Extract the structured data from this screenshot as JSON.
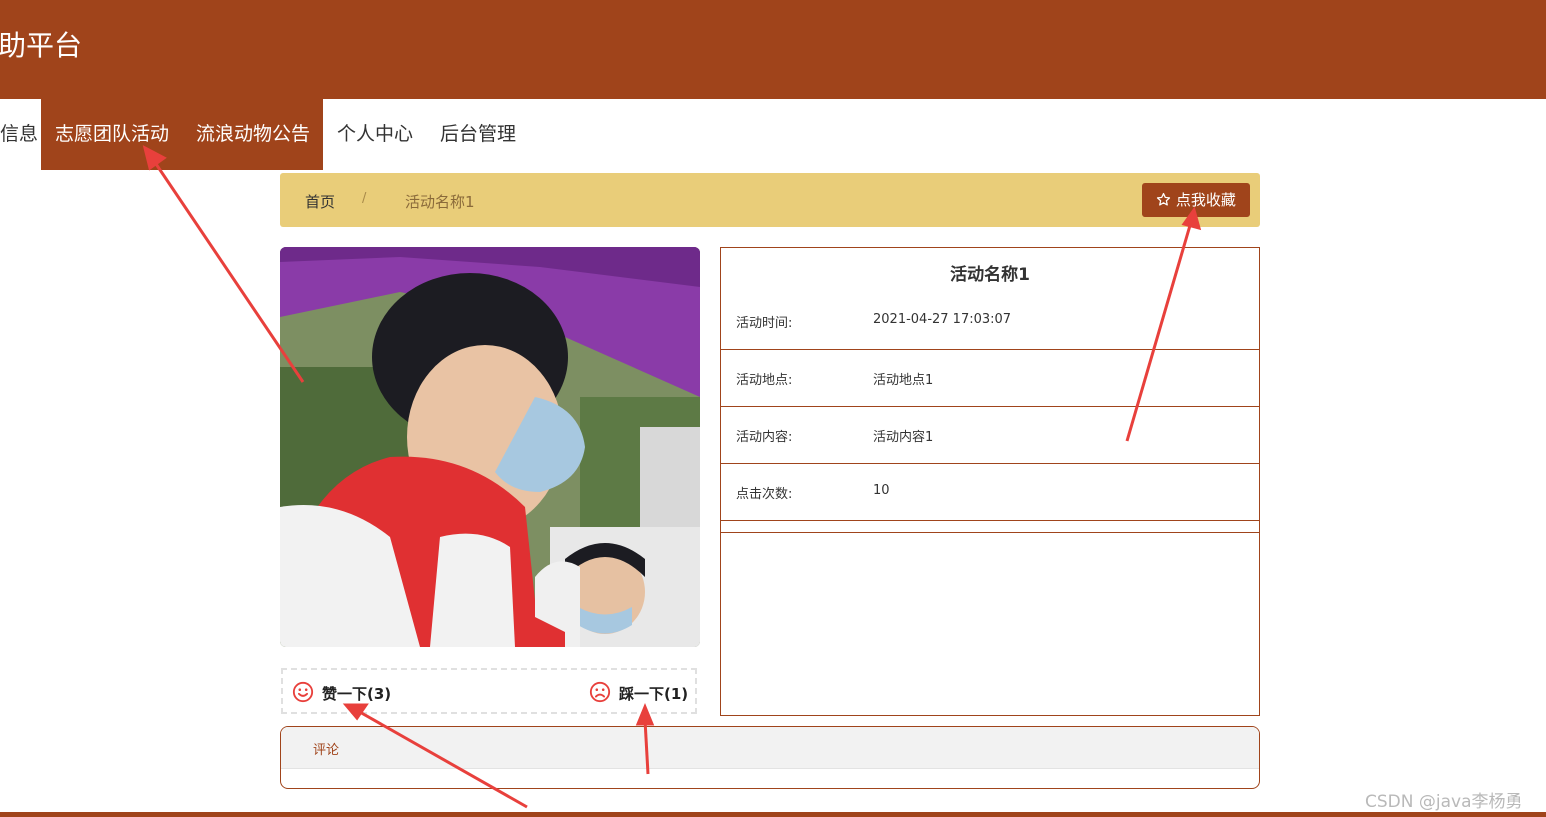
{
  "header": {
    "title": "助平台"
  },
  "nav": {
    "items": [
      {
        "label": "信息"
      },
      {
        "label": "志愿团队活动"
      },
      {
        "label": "流浪动物公告"
      },
      {
        "label": "个人中心"
      },
      {
        "label": "后台管理"
      }
    ]
  },
  "breadcrumb": {
    "home": "首页",
    "separator": "/",
    "current": "活动名称1",
    "favorite_label": "点我收藏",
    "favorite_icon": "star-outline-icon"
  },
  "votes": {
    "like": {
      "label": "赞一下(3)",
      "icon": "smile-face-icon"
    },
    "dislike": {
      "label": "踩一下(1)",
      "icon": "frown-face-icon"
    }
  },
  "details": {
    "title": "活动名称1",
    "rows": [
      {
        "label": "活动时间:",
        "value": "2021-04-27 17:03:07"
      },
      {
        "label": "活动地点:",
        "value": "活动地点1"
      },
      {
        "label": "活动内容:",
        "value": "活动内容1"
      },
      {
        "label": "点击次数:",
        "value": "10"
      }
    ]
  },
  "comments": {
    "tab_label": "评论"
  },
  "watermark": "CSDN @java李杨勇",
  "colors": {
    "brand": "#a0441b",
    "breadcrumb_bg": "#e9cd79",
    "annotation_arrow": "#e8403c"
  }
}
